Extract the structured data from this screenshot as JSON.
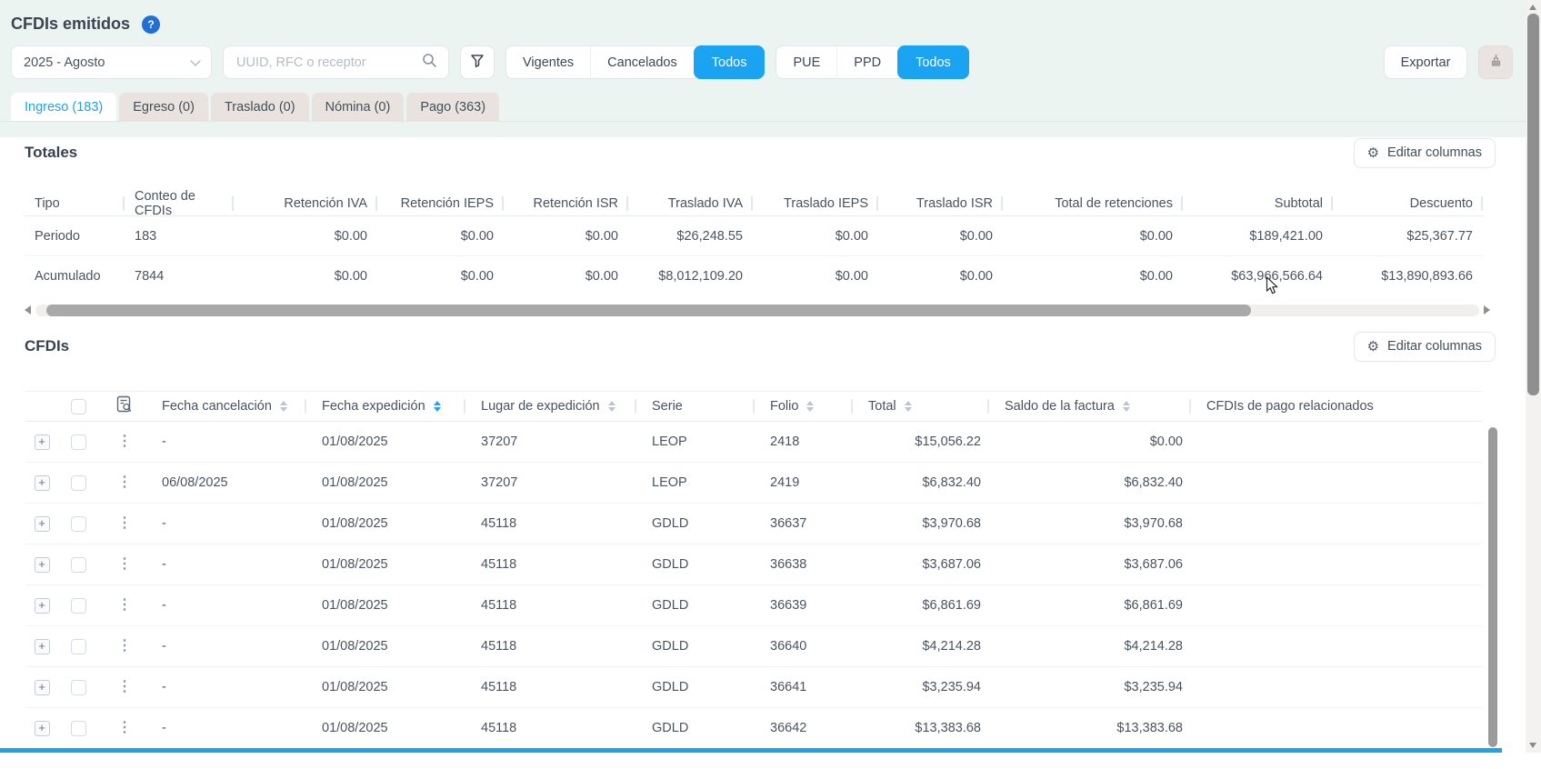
{
  "page": {
    "title": "CFDIs emitidos",
    "help_label": "?"
  },
  "filters": {
    "period_value": "2025 - Agosto",
    "search_placeholder": "UUID, RFC o receptor",
    "status_segments": {
      "vigentes": "Vigentes",
      "cancelados": "Cancelados",
      "todos": "Todos",
      "active": "Todos"
    },
    "payment_segments": {
      "pue": "PUE",
      "ppd": "PPD",
      "todos": "Todos",
      "active": "Todos"
    },
    "export_label": "Exportar"
  },
  "tabs": [
    {
      "label": "Ingreso (183)",
      "active": true
    },
    {
      "label": "Egreso (0)",
      "active": false
    },
    {
      "label": "Traslado (0)",
      "active": false
    },
    {
      "label": "Nómina (0)",
      "active": false
    },
    {
      "label": "Pago (363)",
      "active": false
    }
  ],
  "totales": {
    "title": "Totales",
    "edit_columns_label": "Editar columnas",
    "columns": [
      "Tipo",
      "Conteo de CFDIs",
      "Retención IVA",
      "Retención IEPS",
      "Retención ISR",
      "Traslado IVA",
      "Traslado IEPS",
      "Traslado ISR",
      "Total de retenciones",
      "Subtotal",
      "Descuento"
    ],
    "rows": [
      [
        "Periodo",
        "183",
        "$0.00",
        "$0.00",
        "$0.00",
        "$26,248.55",
        "$0.00",
        "$0.00",
        "$0.00",
        "$189,421.00",
        "$25,367.77"
      ],
      [
        "Acumulado",
        "7844",
        "$0.00",
        "$0.00",
        "$0.00",
        "$8,012,109.20",
        "$0.00",
        "$0.00",
        "$0.00",
        "$63,966,566.64",
        "$13,890,893.66"
      ]
    ]
  },
  "cfdis": {
    "title": "CFDIs",
    "edit_columns_label": "Editar columnas",
    "columns": [
      "Fecha cancelación",
      "Fecha expedición",
      "Lugar de expedición",
      "Serie",
      "Folio",
      "Total",
      "Saldo de la factura",
      "CFDIs de pago relacionados"
    ],
    "sort": {
      "column": "Fecha expedición",
      "direction": "asc"
    },
    "rows": [
      [
        "-",
        "01/08/2025",
        "37207",
        "LEOP",
        "2418",
        "$15,056.22",
        "$0.00",
        ""
      ],
      [
        "06/08/2025",
        "01/08/2025",
        "37207",
        "LEOP",
        "2419",
        "$6,832.40",
        "$6,832.40",
        ""
      ],
      [
        "-",
        "01/08/2025",
        "45118",
        "GDLD",
        "36637",
        "$3,970.68",
        "$3,970.68",
        ""
      ],
      [
        "-",
        "01/08/2025",
        "45118",
        "GDLD",
        "36638",
        "$3,687.06",
        "$3,687.06",
        ""
      ],
      [
        "-",
        "01/08/2025",
        "45118",
        "GDLD",
        "36639",
        "$6,861.69",
        "$6,861.69",
        ""
      ],
      [
        "-",
        "01/08/2025",
        "45118",
        "GDLD",
        "36640",
        "$4,214.28",
        "$4,214.28",
        ""
      ],
      [
        "-",
        "01/08/2025",
        "45118",
        "GDLD",
        "36641",
        "$3,235.94",
        "$3,235.94",
        ""
      ],
      [
        "-",
        "01/08/2025",
        "45118",
        "GDLD",
        "36642",
        "$13,383.68",
        "$13,383.68",
        ""
      ]
    ]
  },
  "colors": {
    "primary_blue": "#1aa3f0",
    "help_badge_blue": "#2170d8",
    "page_background": "#ebf4f0",
    "inactive_tab_background": "#e9e3e0"
  }
}
